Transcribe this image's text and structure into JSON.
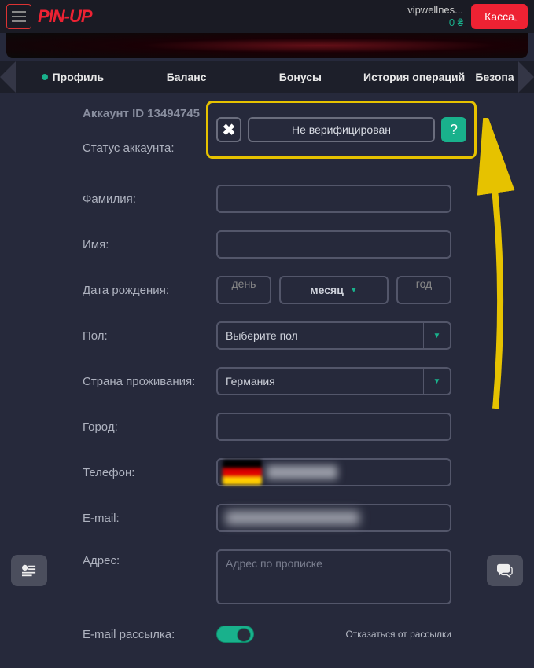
{
  "header": {
    "logo_text": "PIN-UP",
    "user_name": "vipwellnes...",
    "balance": "0 ₴",
    "kassa_label": "Касса"
  },
  "tabs": {
    "items": [
      "Профиль",
      "Баланс",
      "Бонусы",
      "История операций",
      "Безопа"
    ]
  },
  "account": {
    "id_label": "Аккаунт ID 13494745"
  },
  "form": {
    "status_label": "Статус аккаунта:",
    "status_value": "Не верифицирован",
    "help": "?",
    "surname_label": "Фамилия:",
    "name_label": "Имя:",
    "dob_label": "Дата рождения:",
    "dob_day": "день",
    "dob_month": "месяц",
    "dob_year": "год",
    "gender_label": "Пол:",
    "gender_placeholder": "Выберите пол",
    "country_label": "Страна проживания:",
    "country_value": "Германия",
    "city_label": "Город:",
    "phone_label": "Телефон:",
    "email_label": "E-mail:",
    "address_label": "Адрес:",
    "address_placeholder": "Адрес по прописке",
    "maillist_label": "E-mail рассылка:",
    "unsubscribe": "Отказаться от рассылки"
  }
}
